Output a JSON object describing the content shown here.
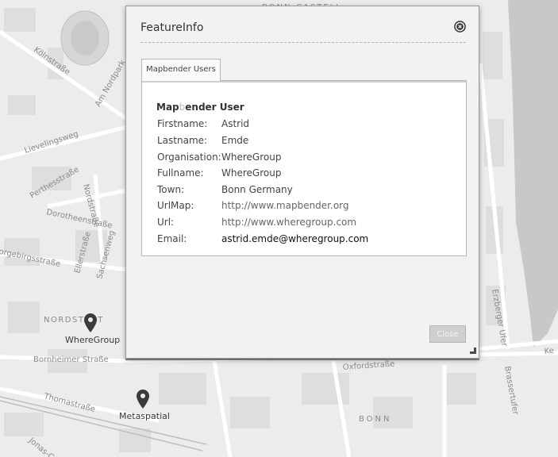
{
  "map": {
    "places": [
      "NORDSTADT",
      "BONN"
    ],
    "streets": [
      "Kölnstraße",
      "Am Nordpark",
      "Lievelingsweg",
      "Perthesstraße",
      "Dorotheenstraße",
      "Vorgebirgsstraße",
      "Bornheimer Straße",
      "Thomastraße",
      "Oxfordstraße",
      "Ellerstraße",
      "Sachsenweg",
      "Nordstraße",
      "Erzberger Ufer",
      "Brassertufer",
      "Ke",
      "BONN-CASTELL",
      "Jonas-C"
    ],
    "markers": [
      {
        "label": "WhereGroup"
      },
      {
        "label": "Metaspatial"
      }
    ]
  },
  "dialog": {
    "title": "FeatureInfo",
    "close_icon": "close-circle-icon",
    "tab_label": "Mapbender Users",
    "heading": {
      "a": "Map",
      "b": "b",
      "c": "ender User"
    },
    "fields": [
      {
        "key": "Firstname:",
        "value": "Astrid"
      },
      {
        "key": "Lastname:",
        "value": "Emde"
      },
      {
        "key": "Organisation:",
        "value": "WhereGroup"
      },
      {
        "key": "Fullname:",
        "value": "WhereGroup"
      },
      {
        "key": "Town:",
        "value": "Bonn Germany"
      },
      {
        "key": "UrlMap:",
        "value": "http://www.mapbender.org"
      },
      {
        "key": "Url:",
        "value": "http://www.wheregroup.com"
      },
      {
        "key": "Email:",
        "value": "astrid.emde@wheregroup.com"
      }
    ],
    "close_button": "Close"
  }
}
